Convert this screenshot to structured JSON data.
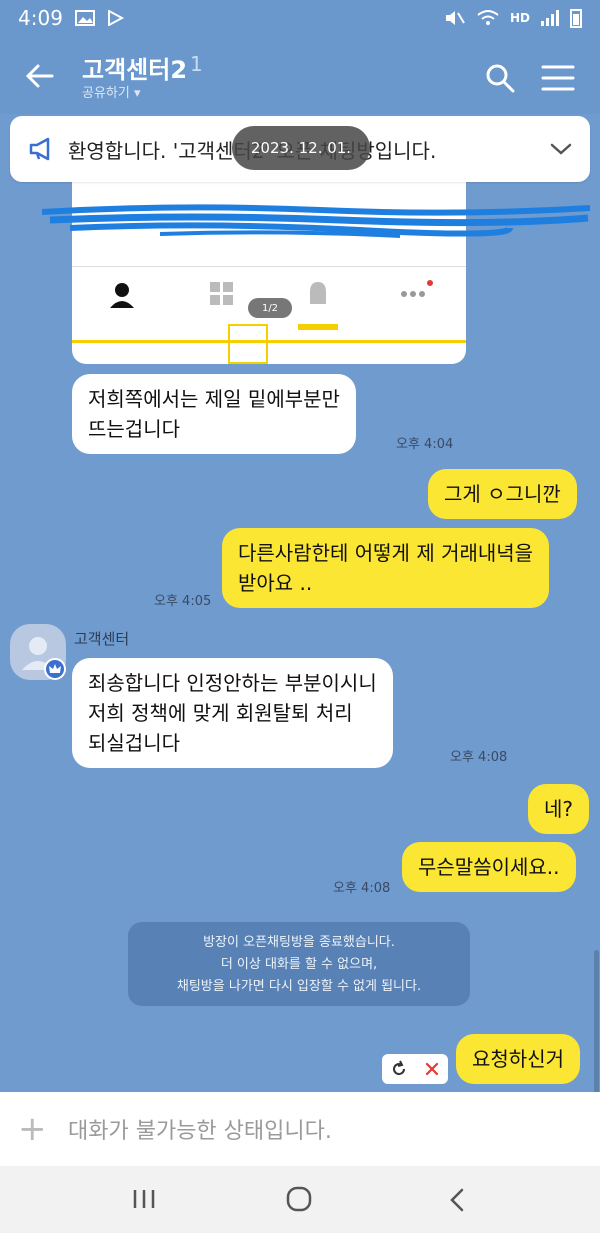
{
  "status_bar": {
    "time": "4:09",
    "network_label": "HD"
  },
  "header": {
    "title": "고객센터2",
    "member_count": "1",
    "subtitle": "공유하기 ▾"
  },
  "notice": {
    "text": "환영합니다. '고객센터2' 오픈 채팅방입니다."
  },
  "date_pill": "2023. 12. 01.",
  "image_card": {
    "page_indicator": "1/2"
  },
  "messages": [
    {
      "id": "m1",
      "side": "in",
      "lines": [
        "저희쪽에서는 제일 밑에부분만",
        "뜨는겁니다"
      ],
      "time": "오후 4:04"
    },
    {
      "id": "m2",
      "side": "out",
      "lines": [
        "그게 ㅇ그니깐"
      ],
      "time": ""
    },
    {
      "id": "m3",
      "side": "out",
      "lines": [
        "다른사람한테 어떻게 제 거래내녁을",
        "받아요 .."
      ],
      "time": "오후 4:05"
    },
    {
      "id": "m4",
      "side": "in",
      "lines": [
        "죄송합니다   인정안하는 부분이시니",
        "저희 정책에 맞게 회원탈퇴 처리",
        "되실겁니다"
      ],
      "time": "오후 4:08"
    },
    {
      "id": "m5",
      "side": "out",
      "lines": [
        "네?"
      ],
      "time": ""
    },
    {
      "id": "m6",
      "side": "out",
      "lines": [
        "무슨말씀이세요.."
      ],
      "time": "오후 4:08"
    },
    {
      "id": "m7",
      "side": "out",
      "lines": [
        "요청하신거"
      ],
      "time": ""
    }
  ],
  "sender_name": "고객센터",
  "system_message": [
    "방장이 오픈채팅방을 종료했습니다.",
    "더 이상 대화를 할 수 없으며,",
    "채팅방을 나가면 다시 입장할 수 없게 됩니다."
  ],
  "input": {
    "placeholder": "대화가 불가능한 상태입니다."
  },
  "colors": {
    "background": "#6f9bcf",
    "header": "#6a97cc",
    "outgoing_bubble": "#fce634",
    "incoming_bubble": "#ffffff"
  },
  "icons": [
    "back-arrow-icon",
    "search-icon",
    "hamburger-menu-icon",
    "megaphone-icon",
    "chevron-down-icon",
    "person-icon",
    "grid-icon",
    "bell-icon",
    "more-dots-icon",
    "crown-badge-icon",
    "retry-icon",
    "delete-x-icon",
    "plus-icon",
    "recent-apps-icon",
    "home-icon",
    "nav-back-icon"
  ]
}
